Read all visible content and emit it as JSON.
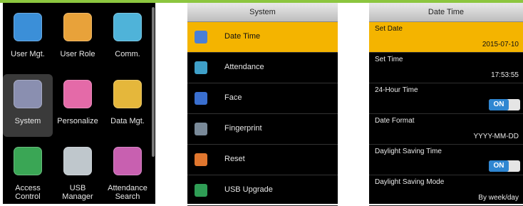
{
  "menu": {
    "items": [
      {
        "label": "User Mgt.",
        "icon": "user-icon",
        "color": "#3b8fd8"
      },
      {
        "label": "User Role",
        "icon": "key-icon",
        "color": "#e8a23a"
      },
      {
        "label": "Comm.",
        "icon": "satellite-icon",
        "color": "#4fb3d9"
      },
      {
        "label": "System",
        "icon": "gear-icon",
        "color": "#8a8fb0"
      },
      {
        "label": "Personalize",
        "icon": "color-wheel-icon",
        "color": "#e46aa8"
      },
      {
        "label": "Data Mgt.",
        "icon": "database-icon",
        "color": "#e5b73b"
      },
      {
        "label": "Access\nControl",
        "icon": "door-icon",
        "color": "#3aa655"
      },
      {
        "label": "USB\nManager",
        "icon": "usb-icon",
        "color": "#bfc7cc"
      },
      {
        "label": "Attendance\nSearch",
        "icon": "magnifier-icon",
        "color": "#c860b0"
      }
    ]
  },
  "system": {
    "title": "System",
    "items": [
      {
        "label": "Date Time",
        "icon": "clock-icon",
        "color": "#4a7fd6"
      },
      {
        "label": "Attendance",
        "icon": "attendance-icon",
        "color": "#3fa0c9"
      },
      {
        "label": "Face",
        "icon": "face-icon",
        "color": "#3a6fcf"
      },
      {
        "label": "Fingerprint",
        "icon": "fingerprint-icon",
        "color": "#7a8a99"
      },
      {
        "label": "Reset",
        "icon": "reset-icon",
        "color": "#e0762e"
      },
      {
        "label": "USB Upgrade",
        "icon": "usb-upgrade-icon",
        "color": "#2f9d55"
      }
    ]
  },
  "datetime": {
    "title": "Date Time",
    "rows": [
      {
        "name": "Set Date",
        "value": "2015-07-10"
      },
      {
        "name": "Set Time",
        "value": "17:53:55"
      },
      {
        "name": "24-Hour Time",
        "toggle": "ON"
      },
      {
        "name": "Date Format",
        "value": "YYYY-MM-DD"
      },
      {
        "name": "Daylight Saving Time",
        "toggle": "ON"
      },
      {
        "name": "Daylight Saving Mode",
        "value": "By week/day"
      }
    ]
  },
  "colors": {
    "accent": "#f4b400",
    "toggle_on": "#2f86d1",
    "top_bar": "#8cc63f"
  }
}
